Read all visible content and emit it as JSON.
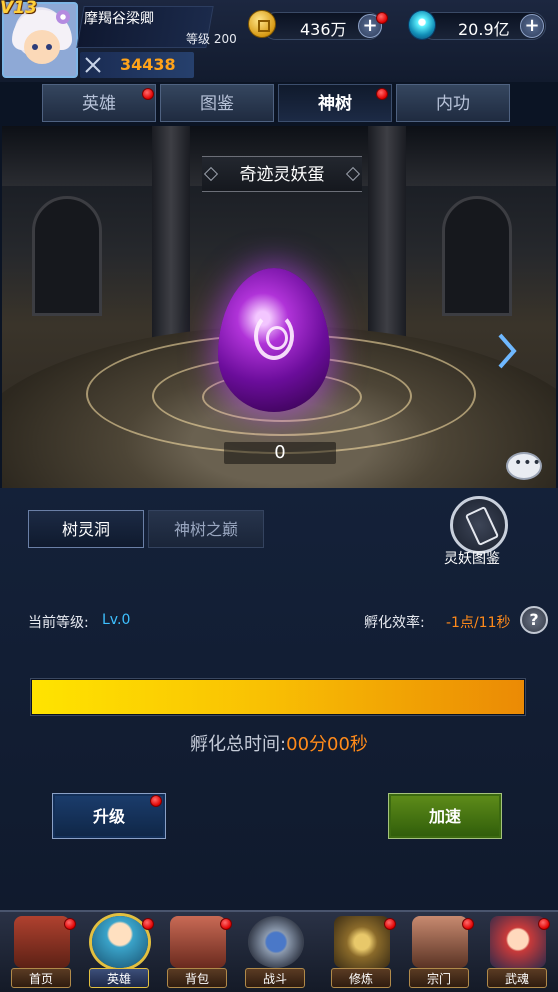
{
  "player": {
    "vip": "V13",
    "name": "摩羯谷梁卿",
    "level": "等级 200",
    "power": "34438"
  },
  "currencies": {
    "gold": "436万",
    "gems": "20.9亿"
  },
  "tabs": [
    {
      "label": "英雄",
      "badge": true
    },
    {
      "label": "图鉴",
      "badge": false
    },
    {
      "label": "神树",
      "badge": true,
      "active": true
    },
    {
      "label": "内功",
      "badge": false
    }
  ],
  "scene": {
    "title": "奇迹灵妖蛋",
    "egg_count": "0"
  },
  "subtabs": [
    {
      "label": "树灵洞",
      "active": true
    },
    {
      "label": "神树之巅",
      "active": false
    }
  ],
  "codex": {
    "label": "灵妖图鉴"
  },
  "stats": {
    "level_label": "当前等级:",
    "level_value": "Lv.0",
    "rate_label": "孵化效率:",
    "rate_value": "-1点/11秒",
    "help": "?"
  },
  "progress": {
    "fraction": 1.0
  },
  "hatch": {
    "label": "孵化总时间:",
    "value": "00分00秒"
  },
  "buttons": {
    "upgrade": "升级",
    "speedup": "加速"
  },
  "nav": [
    {
      "label": "首页",
      "icon": "home-icon",
      "badge": true
    },
    {
      "label": "英雄",
      "icon": "hero-icon",
      "badge": true,
      "active": true
    },
    {
      "label": "背包",
      "icon": "bag-icon",
      "badge": true
    },
    {
      "label": "战斗",
      "icon": "battle-icon",
      "badge": false
    },
    {
      "label": "修炼",
      "icon": "training-icon",
      "badge": true
    },
    {
      "label": "宗门",
      "icon": "sect-icon",
      "badge": true
    },
    {
      "label": "武魂",
      "icon": "martial-soul-icon",
      "badge": true
    }
  ],
  "colors": {
    "accent_orange": "#ffa31a",
    "level_blue": "#3ec0ff",
    "badge_red": "#e00000",
    "progress_start": "#ffe400",
    "progress_end": "#eb8a05"
  }
}
